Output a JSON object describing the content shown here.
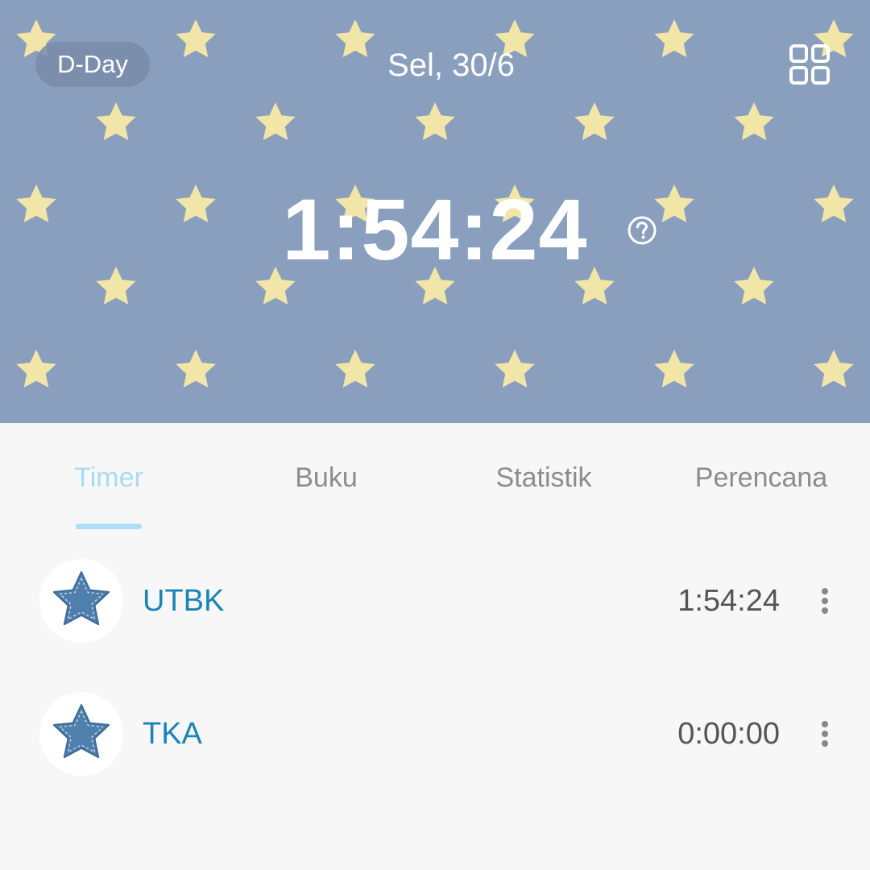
{
  "header": {
    "dday_label": "D-Day",
    "date": "Sel, 30/6",
    "main_timer": "1:54:24",
    "background_color": "#8a9fbd",
    "star_color": "#f1e6a8",
    "grid_icon": "grid-icon",
    "help_icon": "question-circle-icon"
  },
  "tabs": [
    {
      "label": "Timer",
      "active": true
    },
    {
      "label": "Buku",
      "active": false
    },
    {
      "label": "Statistik",
      "active": false
    },
    {
      "label": "Perencana",
      "active": false
    }
  ],
  "subjects": [
    {
      "name": "UTBK",
      "time": "1:54:24",
      "icon": "star-icon",
      "menu_icon": "more-vertical-icon"
    },
    {
      "name": "TKA",
      "time": "0:00:00",
      "icon": "star-icon",
      "menu_icon": "more-vertical-icon"
    }
  ],
  "colors": {
    "accent": "#1a84b7",
    "tab_active": "#a8dcf2",
    "tab_inactive": "#8c8c8c"
  }
}
